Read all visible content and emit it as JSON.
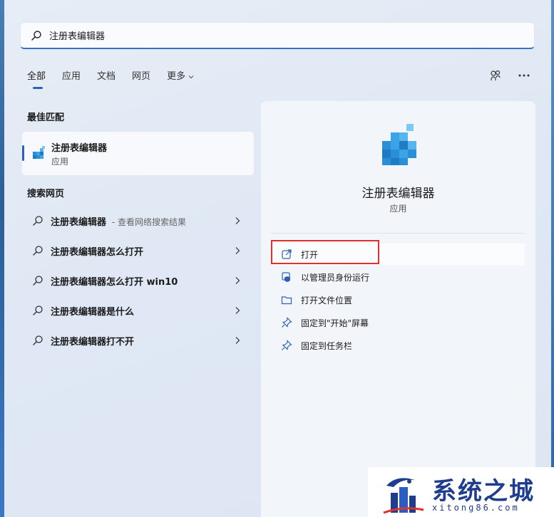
{
  "search": {
    "query": "注册表编辑器"
  },
  "tabs": [
    {
      "label": "全部"
    },
    {
      "label": "应用"
    },
    {
      "label": "文档"
    },
    {
      "label": "网页"
    },
    {
      "label": "更多"
    }
  ],
  "best_match": {
    "title": "最佳匹配",
    "name": "注册表编辑器",
    "type": "应用"
  },
  "web_search": {
    "title": "搜索网页",
    "items": [
      {
        "label": "注册表编辑器",
        "suffix": " - 查看网络搜索结果"
      },
      {
        "label": "注册表编辑器怎么打开",
        "suffix": ""
      },
      {
        "label": "注册表编辑器怎么打开 win10",
        "suffix": ""
      },
      {
        "label": "注册表编辑器是什么",
        "suffix": ""
      },
      {
        "label": "注册表编辑器打不开",
        "suffix": ""
      }
    ]
  },
  "detail": {
    "name": "注册表编辑器",
    "type": "应用",
    "actions": [
      {
        "label": "打开",
        "icon": "open-external-icon"
      },
      {
        "label": "以管理员身份运行",
        "icon": "shield-admin-icon"
      },
      {
        "label": "打开文件位置",
        "icon": "folder-icon"
      },
      {
        "label": "固定到\"开始\"屏幕",
        "icon": "pin-icon"
      },
      {
        "label": "固定到任务栏",
        "icon": "pin-icon"
      }
    ]
  },
  "watermark": {
    "brand": "系统之城",
    "domain": "xitong86.com"
  },
  "colors": {
    "accent": "#2e62b7",
    "highlight": "#e0312f",
    "brand": "#1e3d8f"
  }
}
